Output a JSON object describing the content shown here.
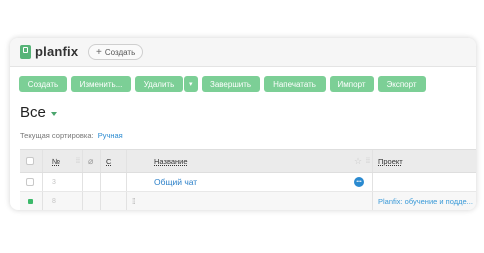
{
  "app": {
    "logo_text": "planfix",
    "create_button": "Создать",
    "create_plus": "+"
  },
  "toolbar": {
    "create": "Создать",
    "edit": "Изменить...",
    "delete": "Удалить",
    "delete_caret": "▾",
    "complete": "Завершить",
    "print": "Напечатать",
    "import": "Импорт",
    "export": "Экспорт"
  },
  "view": {
    "title": "Все"
  },
  "sorting": {
    "label": "Текущая сортировка:",
    "value": "Ручная"
  },
  "table": {
    "headers": {
      "number": "№",
      "column_c": "С",
      "name": "Название",
      "project": "Проект"
    },
    "rows": [
      {
        "number": "3",
        "name": "Общий чат",
        "project": ""
      },
      {
        "number": "8",
        "name": "",
        "project": "Planfix: обучение и подде..."
      }
    ]
  },
  "colors": {
    "accent_green": "#7ccf96",
    "link_blue": "#2a7fc8"
  }
}
